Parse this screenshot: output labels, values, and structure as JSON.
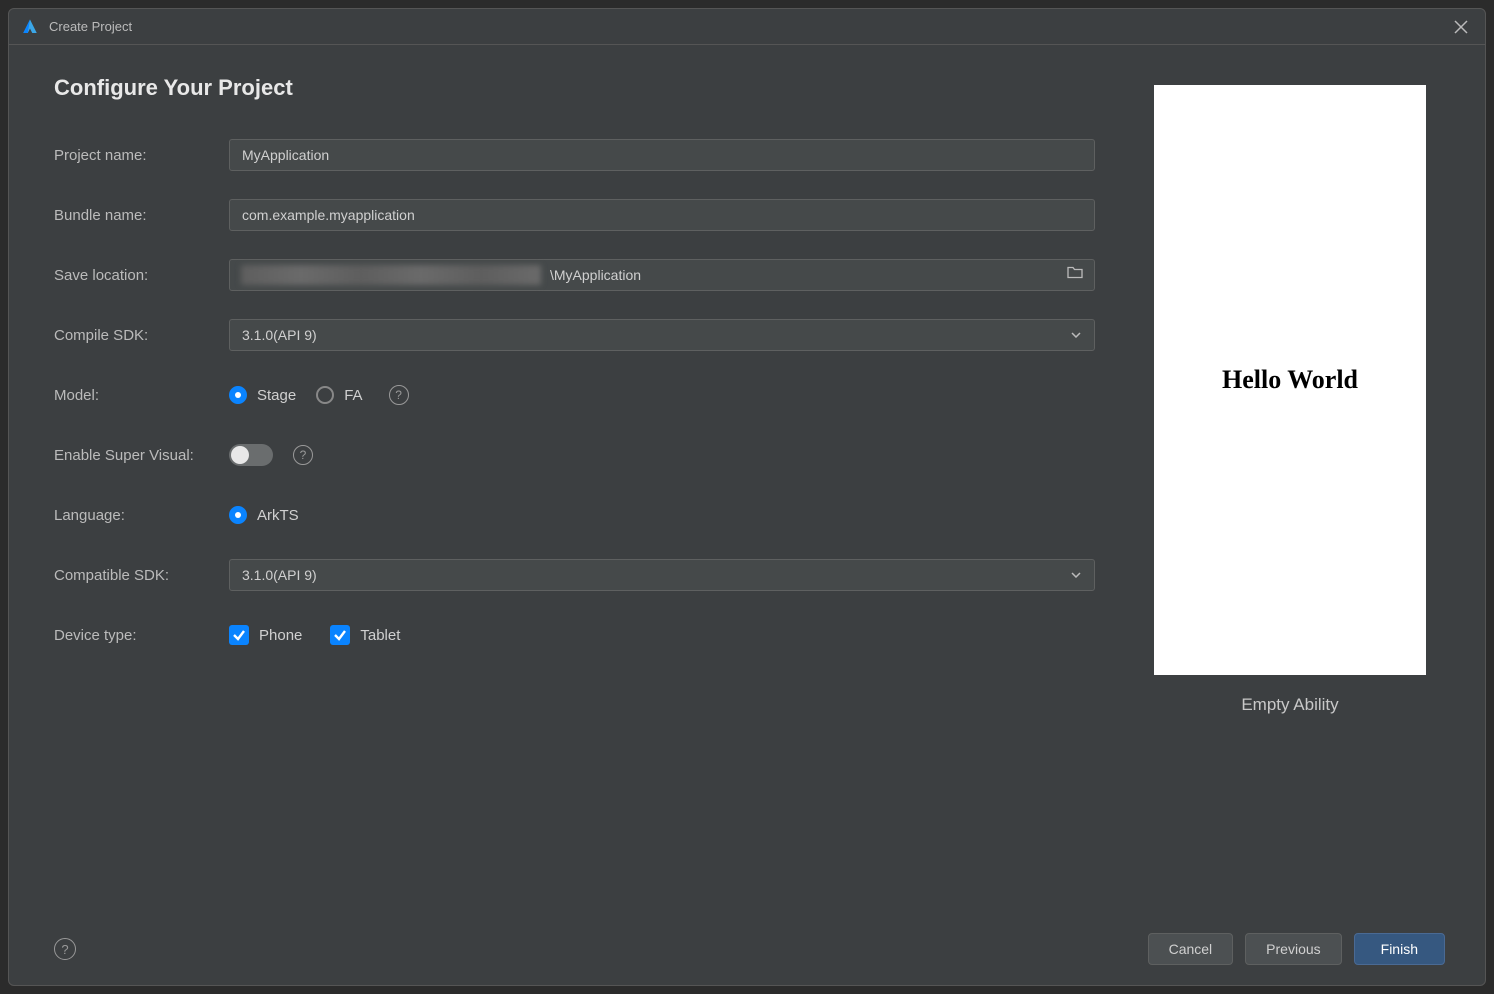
{
  "titlebar": {
    "title": "Create Project"
  },
  "heading": "Configure Your Project",
  "fields": {
    "project_name": {
      "label": "Project name:",
      "value": "MyApplication"
    },
    "bundle_name": {
      "label": "Bundle name:",
      "value": "com.example.myapplication"
    },
    "save_location": {
      "label": "Save location:",
      "suffix": "\\MyApplication"
    },
    "compile_sdk": {
      "label": "Compile SDK:",
      "value": "3.1.0(API 9)"
    },
    "model": {
      "label": "Model:",
      "option1": "Stage",
      "option2": "FA"
    },
    "super_visual": {
      "label": "Enable Super Visual:"
    },
    "language": {
      "label": "Language:",
      "option1": "ArkTS"
    },
    "compatible_sdk": {
      "label": "Compatible SDK:",
      "value": "3.1.0(API 9)"
    },
    "device_type": {
      "label": "Device type:",
      "option1": "Phone",
      "option2": "Tablet"
    }
  },
  "preview": {
    "text": "Hello World",
    "caption": "Empty Ability"
  },
  "footer": {
    "cancel": "Cancel",
    "previous": "Previous",
    "finish": "Finish"
  }
}
